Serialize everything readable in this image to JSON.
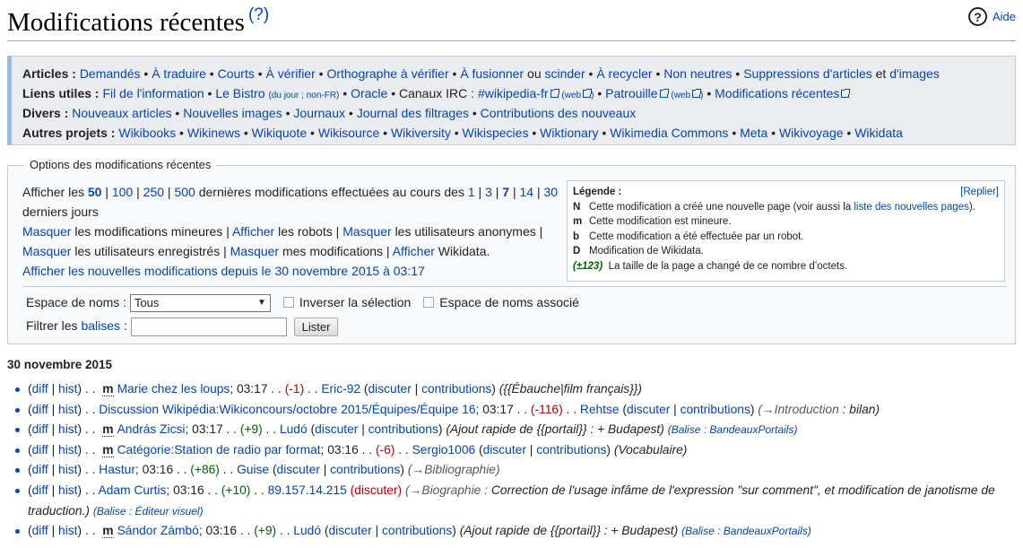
{
  "page": {
    "title": "Modifications récentes",
    "title_help": "(?)",
    "help_label": "Aide"
  },
  "nav": {
    "articles_label": "Articles :",
    "articles": [
      "Demandés",
      "À traduire",
      "Courts",
      "À vérifier",
      "Orthographe à vérifier",
      "À fusionner",
      "scinder",
      "À recycler",
      "Non neutres",
      "Suppressions d'articles",
      "d'images"
    ],
    "word_ou": "ou",
    "word_et": "et",
    "liens_label": "Liens utiles :",
    "liens": {
      "fil": "Fil de l'information",
      "bistro": "Le Bistro",
      "bistro_small": "(du jour ; non-FR)",
      "oracle": "Oracle",
      "canaux": "Canaux IRC :",
      "irc": "#wikipedia-fr",
      "web1": "(web",
      "patrouille": "Patrouille",
      "web2": "(web",
      "modifs": "Modifications récentes"
    },
    "divers_label": "Divers :",
    "divers": [
      "Nouveaux articles",
      "Nouvelles images",
      "Journaux",
      "Journal des filtrages",
      "Contributions des nouveaux"
    ],
    "autres_label": "Autres projets :",
    "autres": [
      "Wikibooks",
      "Wikinews",
      "Wikiquote",
      "Wikisource",
      "Wikiversity",
      "Wikispecies",
      "Wiktionary",
      "Wikimedia Commons",
      "Meta",
      "Wikivoyage",
      "Wikidata"
    ]
  },
  "options": {
    "legend": "Options des modifications récentes",
    "show_prefix": "Afficher les",
    "limits": [
      "50",
      "100",
      "250",
      "500"
    ],
    "limits_suffix": "dernières modifications effectuées au cours des",
    "days": [
      "1",
      "3",
      "7",
      "14",
      "30"
    ],
    "days_suffix": "derniers jours",
    "masquer": "Masquer",
    "afficher": "Afficher",
    "minor": "les modifications mineures |",
    "robots": "les robots |",
    "anon": "les utilisateurs anonymes |",
    "registered": "les utilisateurs enregistrés |",
    "mine": "mes modifications |",
    "wikidata": "Wikidata.",
    "new_since": "Afficher les nouvelles modifications depuis le 30 novembre 2015 à 03:17",
    "namespace_label": "Espace de noms :",
    "namespace_value": "Tous",
    "invert_label": "Inverser la sélection",
    "assoc_label": "Espace de noms associé",
    "filter_prefix": "Filtrer les",
    "filter_link": "balises",
    "filter_suffix": ":",
    "list_button": "Lister"
  },
  "legend_box": {
    "title": "Légende :",
    "hide": "[Replier]",
    "rows": [
      {
        "code": "N",
        "text": "Cette modification a créé une nouvelle page (voir aussi la ",
        "link": "liste des nouvelles pages",
        "after": ")."
      },
      {
        "code": "m",
        "text": "Cette modification est mineure."
      },
      {
        "code": "b",
        "text": "Cette modification a été effectuée par un robot."
      },
      {
        "code": "D",
        "text": "Modification de Wikidata."
      }
    ],
    "size_code": "(±123)",
    "size_text": "La taille de la page a changé de ce nombre d’octets."
  },
  "changes": {
    "date": "30 novembre 2015",
    "diff": "diff",
    "hist": "hist",
    "talk": "discuter",
    "contribs": "contributions",
    "items": [
      {
        "minor": true,
        "page": "Marie chez les loups",
        "time": "03:17",
        "delta": "(-1)",
        "user": "Eric-92",
        "comment": "({{Ébauche|film français}})"
      },
      {
        "minor": false,
        "page": "Discussion Wikipédia:Wikiconcours/octobre 2015/Équipes/Équipe 16",
        "time": "03:17",
        "delta": "(-116)",
        "user": "Rehtse",
        "arrow": "(→Introduction",
        "comment": ": bilan)"
      },
      {
        "minor": true,
        "page": "András Zicsi",
        "time": "03:17",
        "delta": "(+9)",
        "user": "Ludó",
        "comment": "(Ajout rapide de {{portail}} : + Budapest)",
        "tag": "(Balise : BandeauxPortails)"
      },
      {
        "minor": true,
        "page": "Catégorie:Station de radio par format",
        "time": "03:16",
        "delta": "(-6)",
        "user": "Sergio1006",
        "comment": "(Vocabulaire)"
      },
      {
        "minor": false,
        "page": "Hastur",
        "time": "03:16",
        "delta": "(+86)",
        "user": "Guise",
        "arrow": "(→Bibliographie)"
      },
      {
        "minor": false,
        "page": "Adam Curtis",
        "time": "03:16",
        "delta": "(+10)",
        "ip": "89.157.14.215",
        "talk_red": "(discuter)",
        "arrow": "(→Biographie :",
        "comment": "Correction de l'usage infâme de l'expression \"sur comment\", et modification de janotisme de traduction.)",
        "tag": "(Balise : Éditeur visuel)"
      },
      {
        "minor": true,
        "page": "Sándor Zámbó",
        "time": "03:16",
        "delta": "(+9)",
        "user": "Ludó",
        "comment": "(Ajout rapide de {{portail}} : + Budapest)",
        "tag": "(Balise : BandeauxPortails)"
      }
    ]
  }
}
